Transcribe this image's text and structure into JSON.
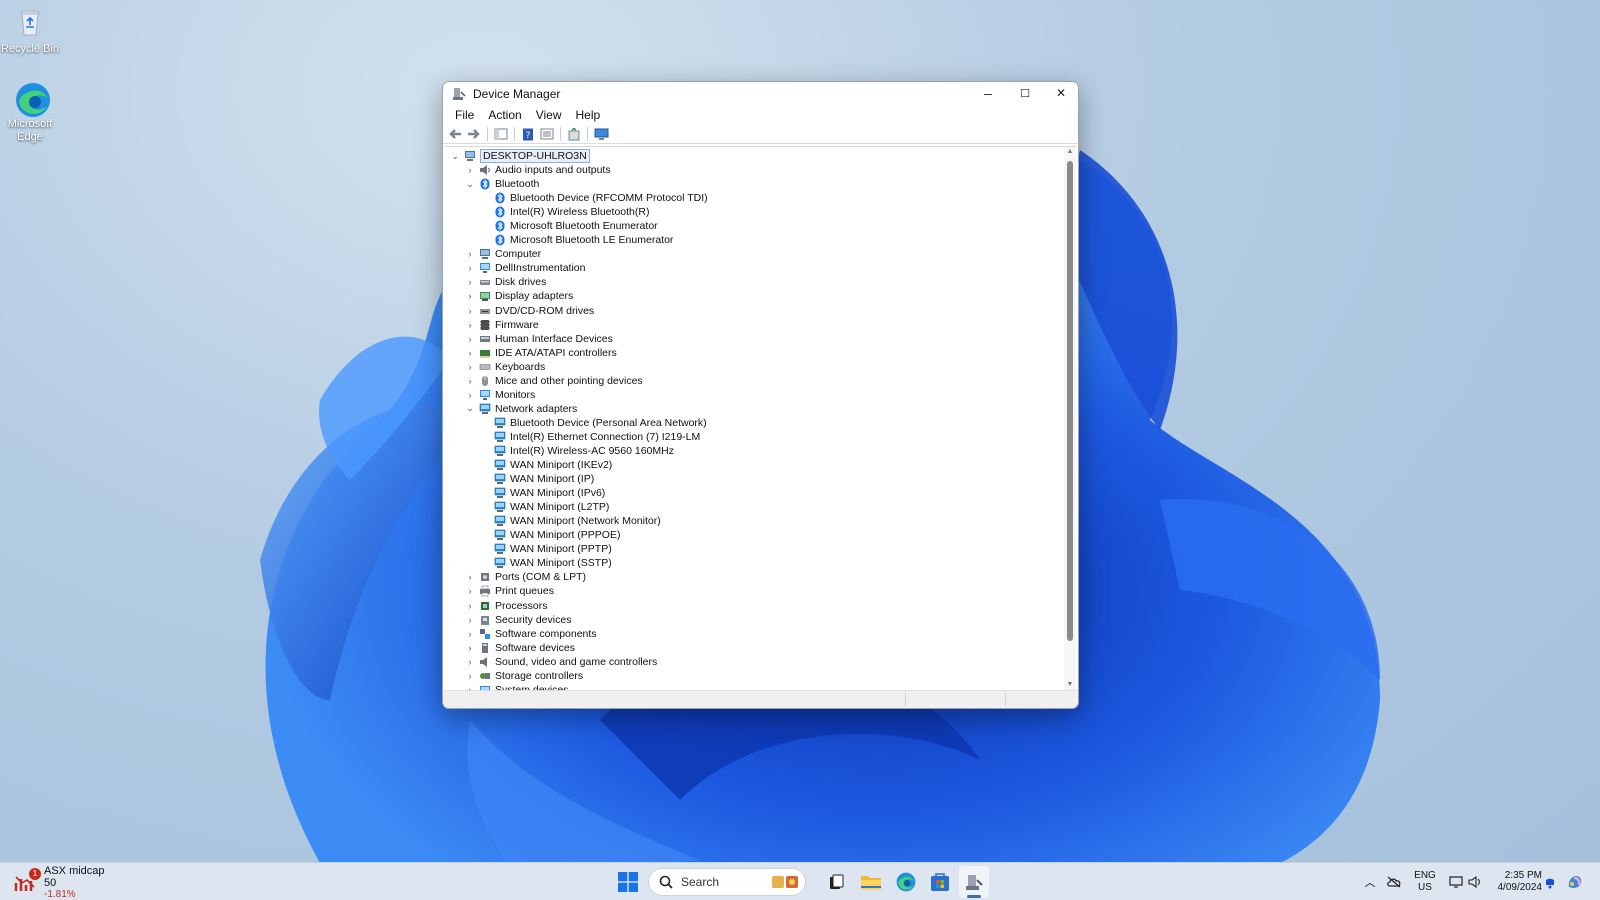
{
  "desktop": {
    "icons": [
      {
        "label": "Recycle Bin",
        "icon": "recycle-bin-icon"
      },
      {
        "label": "Microsoft Edge",
        "icon": "edge-icon"
      }
    ]
  },
  "window": {
    "title": "Device Manager",
    "menu": [
      "File",
      "Action",
      "View",
      "Help"
    ],
    "controls": {
      "minimize": "–",
      "maximize": "☐",
      "close": "✕"
    },
    "toolbar": [
      "back-icon",
      "forward-icon",
      "show-hide-console-tree-icon",
      "help-icon",
      "properties-icon",
      "update-driver-icon",
      "scan-hardware-icon"
    ]
  },
  "tree": {
    "root": "DESKTOP-UHLRO3N",
    "nodes": [
      {
        "label": "Audio inputs and outputs",
        "icon": "speaker-icon",
        "level": 1,
        "expanded": false
      },
      {
        "label": "Bluetooth",
        "icon": "bluetooth-icon",
        "level": 1,
        "expanded": true
      },
      {
        "label": "Bluetooth Device (RFCOMM Protocol TDI)",
        "icon": "bluetooth-icon",
        "level": 2
      },
      {
        "label": "Intel(R) Wireless Bluetooth(R)",
        "icon": "bluetooth-icon",
        "level": 2
      },
      {
        "label": "Microsoft Bluetooth Enumerator",
        "icon": "bluetooth-icon",
        "level": 2
      },
      {
        "label": "Microsoft Bluetooth LE Enumerator",
        "icon": "bluetooth-icon",
        "level": 2
      },
      {
        "label": "Computer",
        "icon": "computer-icon",
        "level": 1,
        "expanded": false
      },
      {
        "label": "DellInstrumentation",
        "icon": "monitor-icon",
        "level": 1,
        "expanded": false
      },
      {
        "label": "Disk drives",
        "icon": "disk-icon",
        "level": 1,
        "expanded": false
      },
      {
        "label": "Display adapters",
        "icon": "display-adapter-icon",
        "level": 1,
        "expanded": false
      },
      {
        "label": "DVD/CD-ROM drives",
        "icon": "dvd-icon",
        "level": 1,
        "expanded": false
      },
      {
        "label": "Firmware",
        "icon": "firmware-icon",
        "level": 1,
        "expanded": false
      },
      {
        "label": "Human Interface Devices",
        "icon": "hid-icon",
        "level": 1,
        "expanded": false
      },
      {
        "label": "IDE ATA/ATAPI controllers",
        "icon": "ide-icon",
        "level": 1,
        "expanded": false
      },
      {
        "label": "Keyboards",
        "icon": "keyboard-icon",
        "level": 1,
        "expanded": false
      },
      {
        "label": "Mice and other pointing devices",
        "icon": "mouse-icon",
        "level": 1,
        "expanded": false
      },
      {
        "label": "Monitors",
        "icon": "monitor-icon",
        "level": 1,
        "expanded": false
      },
      {
        "label": "Network adapters",
        "icon": "network-icon",
        "level": 1,
        "expanded": true
      },
      {
        "label": "Bluetooth Device (Personal Area Network)",
        "icon": "network-icon",
        "level": 2
      },
      {
        "label": "Intel(R) Ethernet Connection (7) I219-LM",
        "icon": "network-icon",
        "level": 2
      },
      {
        "label": "Intel(R) Wireless-AC 9560 160MHz",
        "icon": "network-icon",
        "level": 2
      },
      {
        "label": "WAN Miniport (IKEv2)",
        "icon": "network-icon",
        "level": 2
      },
      {
        "label": "WAN Miniport (IP)",
        "icon": "network-icon",
        "level": 2
      },
      {
        "label": "WAN Miniport (IPv6)",
        "icon": "network-icon",
        "level": 2
      },
      {
        "label": "WAN Miniport (L2TP)",
        "icon": "network-icon",
        "level": 2
      },
      {
        "label": "WAN Miniport (Network Monitor)",
        "icon": "network-icon",
        "level": 2
      },
      {
        "label": "WAN Miniport (PPPOE)",
        "icon": "network-icon",
        "level": 2
      },
      {
        "label": "WAN Miniport (PPTP)",
        "icon": "network-icon",
        "level": 2
      },
      {
        "label": "WAN Miniport (SSTP)",
        "icon": "network-icon",
        "level": 2
      },
      {
        "label": "Ports (COM & LPT)",
        "icon": "port-icon",
        "level": 1,
        "expanded": false
      },
      {
        "label": "Print queues",
        "icon": "printer-icon",
        "level": 1,
        "expanded": false
      },
      {
        "label": "Processors",
        "icon": "processor-icon",
        "level": 1,
        "expanded": false
      },
      {
        "label": "Security devices",
        "icon": "security-icon",
        "level": 1,
        "expanded": false
      },
      {
        "label": "Software components",
        "icon": "software-component-icon",
        "level": 1,
        "expanded": false
      },
      {
        "label": "Software devices",
        "icon": "software-device-icon",
        "level": 1,
        "expanded": false
      },
      {
        "label": "Sound, video and game controllers",
        "icon": "sound-icon",
        "level": 1,
        "expanded": false
      },
      {
        "label": "Storage controllers",
        "icon": "storage-icon",
        "level": 1,
        "expanded": false
      },
      {
        "label": "System devices",
        "icon": "system-icon",
        "level": 1,
        "expanded": false
      }
    ]
  },
  "taskbar": {
    "widget": {
      "title": "ASX midcap 50",
      "change": "-1.81%",
      "badge": "1"
    },
    "search_placeholder": "Search",
    "apps": [
      "start-icon",
      "search-icon",
      "widgets-highlight-icon",
      "task-view-icon",
      "file-explorer-icon",
      "edge-icon",
      "store-icon",
      "device-manager-icon"
    ],
    "tray": {
      "language": "ENG",
      "region": "US",
      "time": "2:35 PM",
      "date": "4/09/2024"
    }
  },
  "colors": {
    "accent": "#0067c0",
    "bluetooth": "#1a73e8",
    "network": "#2b8fd6",
    "negative": "#c42b1c"
  }
}
